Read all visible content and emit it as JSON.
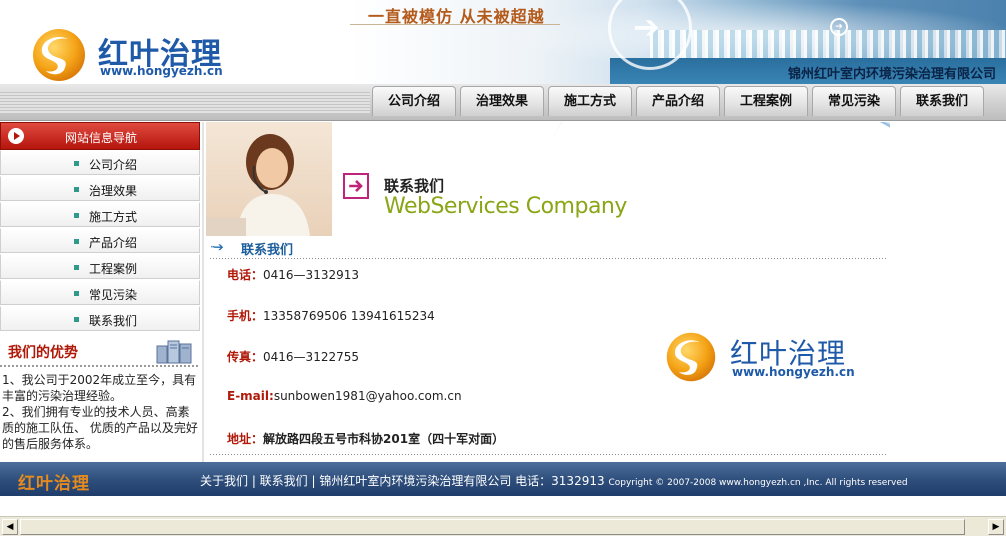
{
  "header": {
    "brand": "红叶治理",
    "url": "www.hongyezh.cn",
    "slogan": "一直被模仿  从未被超越",
    "company": "锦州红叶室内环境污染治理有限公司"
  },
  "nav": [
    {
      "label": "公司介绍"
    },
    {
      "label": "治理效果"
    },
    {
      "label": "施工方式"
    },
    {
      "label": "产品介绍"
    },
    {
      "label": "工程案例"
    },
    {
      "label": "常见污染"
    },
    {
      "label": "联系我们"
    }
  ],
  "sidebar": {
    "nav_title": "网站信息导航",
    "items": [
      {
        "label": "公司介绍"
      },
      {
        "label": "治理效果"
      },
      {
        "label": "施工方式"
      },
      {
        "label": "产品介绍"
      },
      {
        "label": "工程案例"
      },
      {
        "label": "常见污染"
      },
      {
        "label": "联系我们"
      }
    ],
    "advantage_title": "我们的优势",
    "advantage_text": [
      "1、我公司于2002年成立至今，具有丰富的污染治理经验。",
      "2、我们拥有专业的技术人员、高素质的施工队伍、 优质的产品以及完好的售后服务体系。"
    ]
  },
  "main": {
    "banner_title": "联系我们",
    "banner_subtitle": "WebServices Company",
    "section_title": "联系我们",
    "contacts": [
      {
        "label": "电话：",
        "value": "0416—3132913"
      },
      {
        "label": "手机：",
        "value": "13358769506 13941615234"
      },
      {
        "label": "传真：",
        "value": "0416—3122755"
      },
      {
        "label": "E-mail:",
        "value": "sunbowen1981@yahoo.com.cn"
      },
      {
        "label": "地址：",
        "value": "解放路四段五号市科协201室（四十军对面）"
      }
    ],
    "logo_brand": "红叶治理",
    "logo_url": "www.hongyezh.cn"
  },
  "footer": {
    "logo": "红叶治理",
    "links_text": "关于我们 | 联系我们 | 锦州红叶室内环境污染治理有限公司 电话：3132913",
    "copyright": "Copyright © 2007-2008 www.hongyezh.cn ,Inc. All rights reserved"
  },
  "colors": {
    "nav_header_red": "#b5150d",
    "footer_navy": "#2f4f7d",
    "brand_blue": "#1f5aa8",
    "accent_orange": "#e58a1f",
    "label_red": "#b01808"
  },
  "icons": [
    "swirl-logo-icon",
    "play-arrow-icon",
    "square-bullet-icon",
    "server-icon",
    "arrow-box-icon",
    "dotted-arrow-icon",
    "scroll-left-icon",
    "scroll-right-icon"
  ]
}
